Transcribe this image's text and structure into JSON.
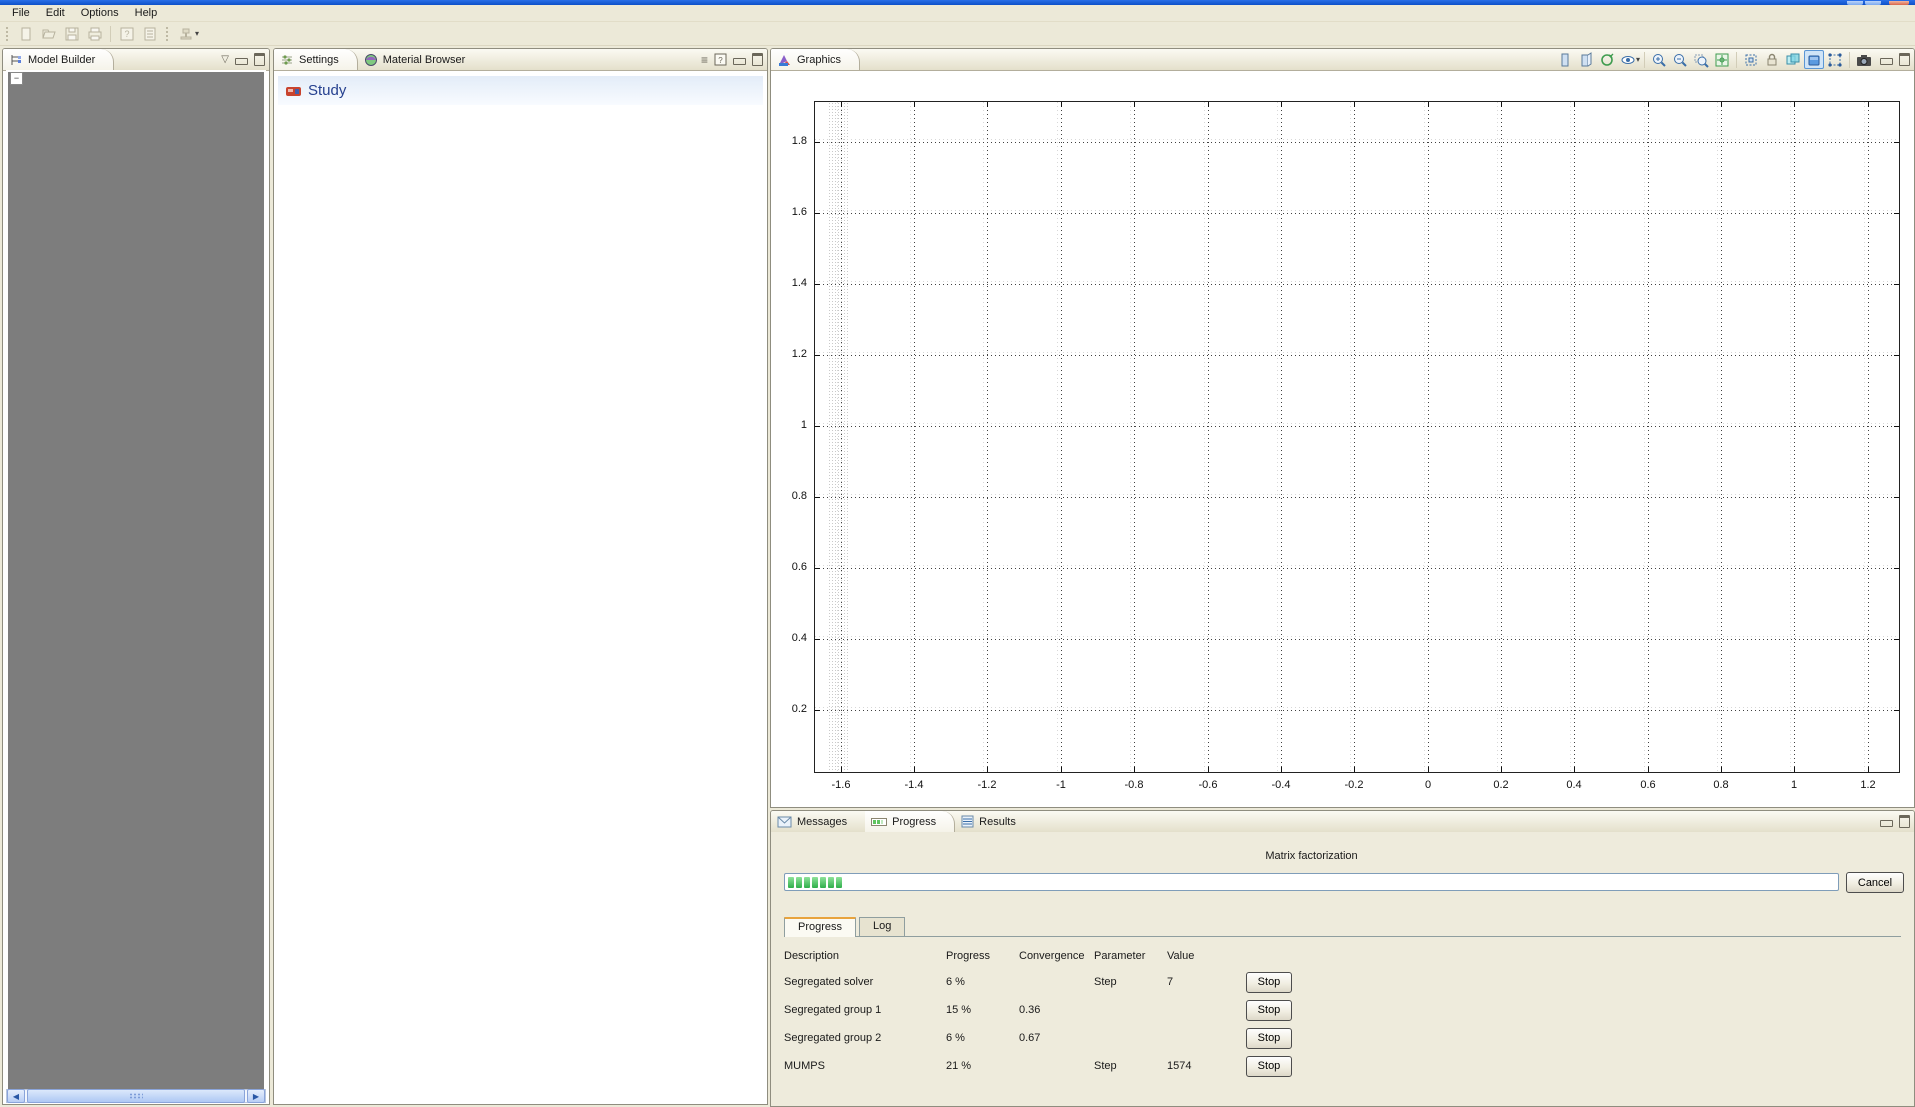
{
  "window": {
    "titlebar_color": "#0d50c8",
    "background_color": "#ece9d8",
    "accent_blue": "#25408f"
  },
  "menu": {
    "items": [
      "File",
      "Edit",
      "Options",
      "Help"
    ]
  },
  "main_toolbar": {
    "icons": [
      "new-file-icon",
      "open-icon",
      "save-icon",
      "print-icon",
      "help-icon",
      "report-icon",
      "plot-icon",
      "dropdown-caret-icon"
    ]
  },
  "model_builder": {
    "title": "Model Builder",
    "expander_glyph": "−",
    "header_icons": [
      "menu-chevron-icon",
      "minimize-icon",
      "maximize-icon"
    ]
  },
  "settings_panel": {
    "tabs": [
      {
        "label": "Settings",
        "icon": "settings-sliders-icon",
        "active": true
      },
      {
        "label": "Material Browser",
        "icon": "material-globe-icon",
        "active": false
      }
    ],
    "header_icons": [
      "hamburger-icon",
      "help-page-icon",
      "minimize-icon",
      "maximize-icon"
    ],
    "study_title": "Study",
    "study_icon": "study-icon"
  },
  "graphics_panel": {
    "tab_label": "Graphics",
    "tab_icon": "graphics-plot-icon",
    "toolbar_icons": [
      "front-view-icon",
      "back-view-icon",
      "orbit-icon",
      "visibility-eye-icon",
      "dropdown-caret-icon",
      "zoom-in-icon",
      "zoom-out-icon",
      "zoom-box-icon",
      "zoom-extents-icon",
      "select-frame-icon",
      "lock-icon",
      "transparency-icon",
      "scene-box-icon",
      "select-vertices-icon",
      "camera-icon"
    ],
    "pressed_icon": "scene-box-icon",
    "header_icons": [
      "minimize-icon",
      "maximize-icon"
    ]
  },
  "chart_data": {
    "type": "scatter",
    "title": "",
    "xlabel": "",
    "ylabel": "",
    "series": [],
    "note": "empty axes with dotted grid, no data plotted yet",
    "x_ticks": [
      -1.6,
      -1.4,
      -1.2,
      -1,
      -0.8,
      -0.6,
      -0.4,
      -0.2,
      0,
      0.2,
      0.4,
      0.6,
      0.8,
      1,
      1.2
    ],
    "y_ticks": [
      0.2,
      0.4,
      0.6,
      0.8,
      1,
      1.2,
      1.4,
      1.6,
      1.8
    ],
    "xlim": [
      -1.67,
      1.285
    ],
    "ylim": [
      0.025,
      1.912
    ],
    "grid": "dotted",
    "band": {
      "x0": -1.635,
      "x1": -1.575
    }
  },
  "bottom_panel": {
    "tabs": [
      {
        "label": "Messages",
        "icon": "envelope-icon",
        "active": false
      },
      {
        "label": "Progress",
        "icon": "progress-bar-icon",
        "active": true
      },
      {
        "label": "Results",
        "icon": "results-table-icon",
        "active": false
      }
    ],
    "header_icons": [
      "minimize-icon",
      "maximize-icon"
    ],
    "task_label": "Matrix factorization",
    "progress_blocks": 7,
    "cancel_label": "Cancel",
    "sub_tabs": [
      {
        "label": "Progress",
        "active": true
      },
      {
        "label": "Log",
        "active": false
      }
    ],
    "table": {
      "columns": [
        "Description",
        "Progress",
        "Convergence",
        "Parameter",
        "Value"
      ],
      "rows": [
        {
          "description": "Segregated solver",
          "progress": "6 %",
          "convergence": "",
          "parameter": "Step",
          "value": "7",
          "action": "Stop"
        },
        {
          "description": "Segregated group 1",
          "progress": "15 %",
          "convergence": "0.36",
          "parameter": "",
          "value": "",
          "action": "Stop"
        },
        {
          "description": "Segregated group 2",
          "progress": "6 %",
          "convergence": "0.67",
          "parameter": "",
          "value": "",
          "action": "Stop"
        },
        {
          "description": "MUMPS",
          "progress": "21 %",
          "convergence": "",
          "parameter": "Step",
          "value": "1574",
          "action": "Stop"
        }
      ]
    }
  }
}
